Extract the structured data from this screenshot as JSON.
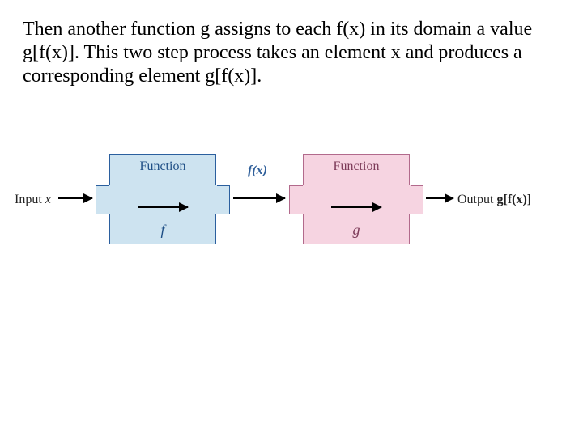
{
  "paragraph": "Then another function g assigns to each f(x) in its domain a value g[f(x)].  This two step process takes an element x and produces a corresponding element g[f(x)].",
  "diagram": {
    "input_label_prefix": "Input ",
    "input_var": "x",
    "box_f": {
      "title": "Function",
      "name": "f"
    },
    "mid_label": "f(x)",
    "box_g": {
      "title": "Function",
      "name": "g"
    },
    "output_label_prefix": "Output ",
    "output_expr": "g[f(x)]"
  }
}
